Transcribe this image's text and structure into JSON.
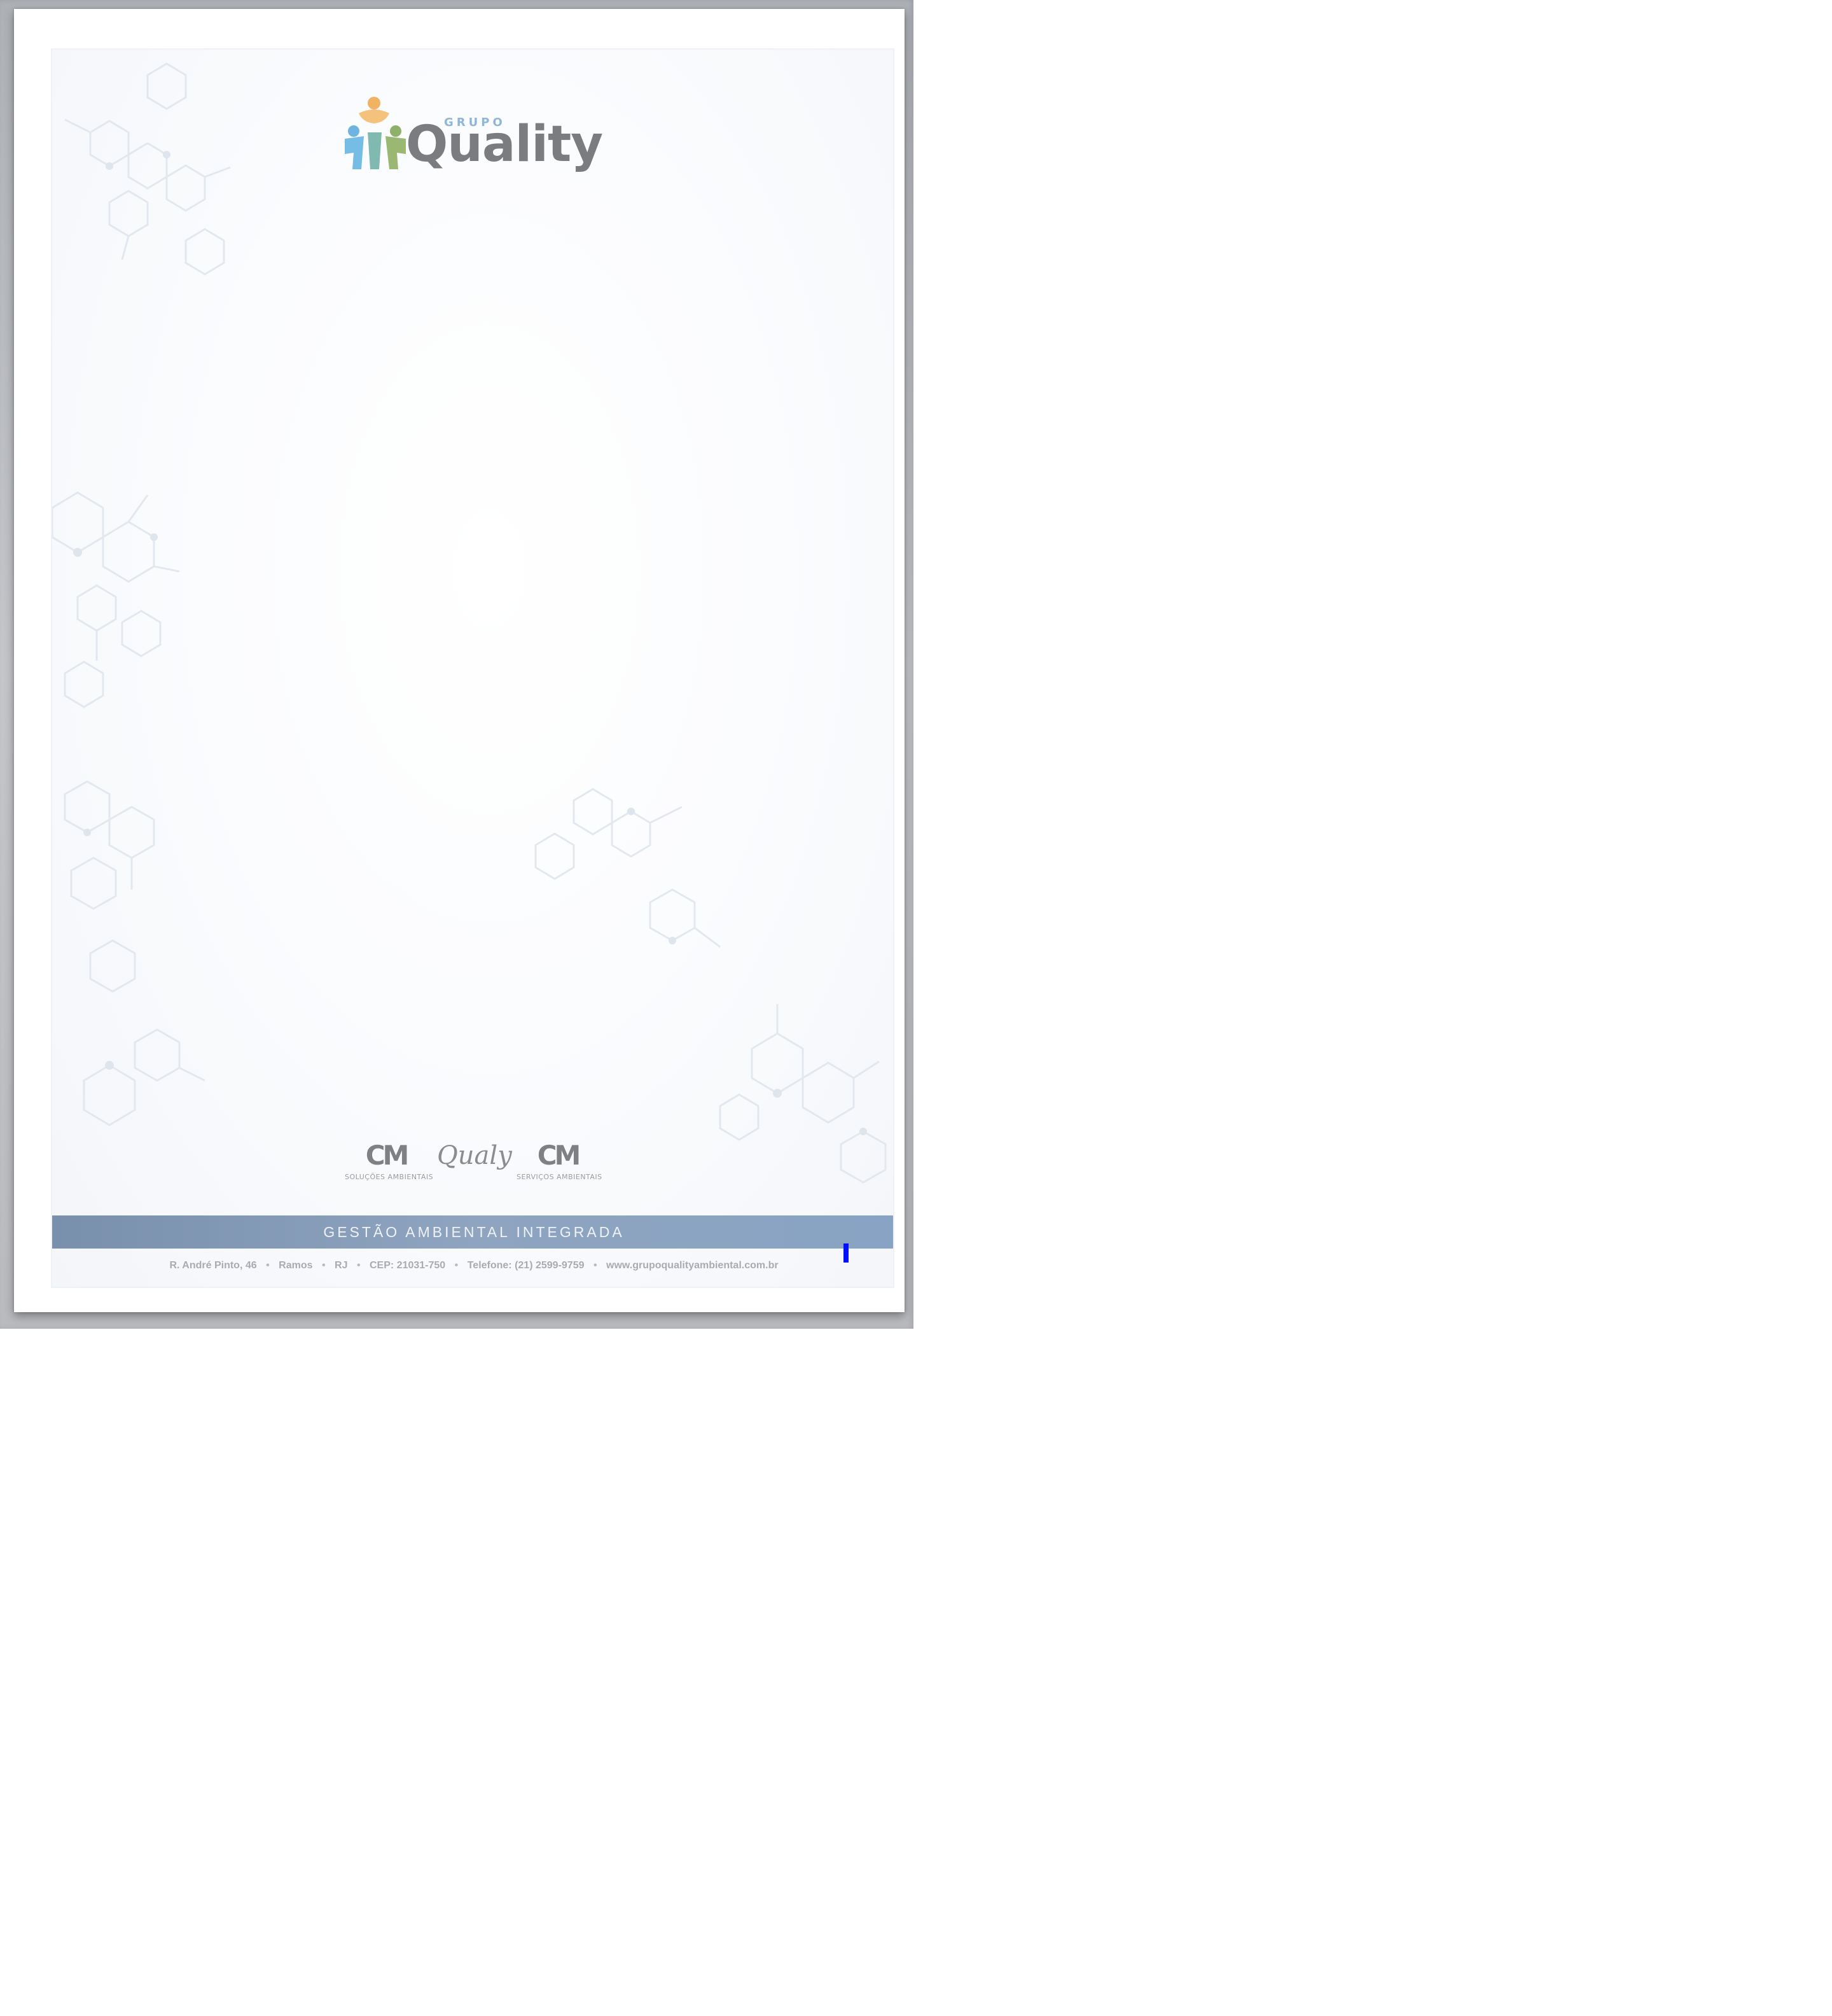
{
  "header": {
    "brand_small": "GRUPO",
    "brand_name": "Quality"
  },
  "partners": [
    {
      "mark": "CM",
      "caption": "SOLUÇÕES AMBIENTAIS"
    },
    {
      "mark": "Qualy",
      "caption": ""
    },
    {
      "mark": "CM",
      "caption": "SERVIÇOS AMBIENTAIS"
    }
  ],
  "band": {
    "tagline": "GESTÃO AMBIENTAL INTEGRADA"
  },
  "contact": {
    "address": "R. André Pinto, 46",
    "district": "Ramos",
    "state": "RJ",
    "cep": "CEP: 21031-750",
    "phone": "Telefone: (21) 2599-9759",
    "website": "www.grupoqualityambiental.com.br",
    "separator": "•"
  },
  "colors": {
    "band": "#8aa0bb",
    "logo_orange": "#f2b264",
    "logo_blue": "#6fb4e0",
    "logo_green": "#8fb06a",
    "logo_text": "#7a7c80",
    "caret": "#0010ff"
  },
  "icons": {
    "logo_mark": "three-people-figures-icon",
    "partner_logo": "cm-monogram-icon"
  }
}
